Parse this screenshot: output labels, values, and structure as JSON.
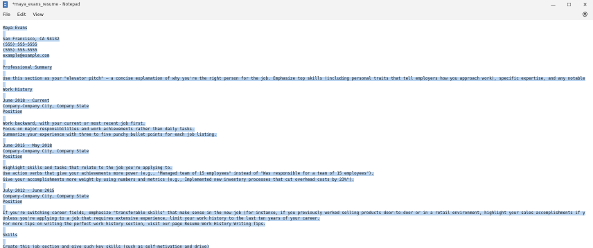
{
  "window": {
    "title": "*maya_evans_resume - Notepad",
    "controls": {
      "minimize": "—",
      "maximize": "☐",
      "close": "✕"
    }
  },
  "menu": {
    "file": "File",
    "edit": "Edit",
    "view": "View"
  },
  "document": {
    "lines": [
      "Maya Evans",
      "",
      "San Francisco, CA 94132",
      "(555) 555-5555",
      "(555) 555-5555",
      "example@example.com",
      "",
      "Professional Summary",
      "",
      "Use this section as your \"elevator pitch\" – a concise explanation of why you're the right person for the job. Emphasize top skills (including personal traits that tell employers how you approach work), specific expertise, and any notable",
      "",
      "Work History",
      "",
      "June 2018 - Current",
      "Company-Company City, Company State",
      "Position",
      "",
      "Work backward, with your current or most recent job first.",
      "Focus on major responsibilities and work achievements rather than daily tasks.",
      "Summarize your experience with three to five punchy bullet points for each job listing.",
      "",
      "June 2015 - May 2018",
      "Company-Company City, Company State",
      "Position",
      "",
      "Highlight skills and tasks that relate to the job you're applying to.",
      "Use action verbs that give your achievements more power (e.g., \"Managed team of 15 employees\" instead of \"Was responsible for a team of 15 employees\").",
      "Give your accomplishments more weight by using numbers and metrics (e.g., Implemented new inventory processes that cut overhead costs by 23%\").",
      "",
      "July 2012 - June 2015",
      "Company-Company City, Company State",
      "Position",
      "",
      "If you're switching career fields, emphasize \"transferable skills\" that make sense in the new job (for instance, if you previously worked selling products door-to-door or in a retail environment, highlight your sales accomplishments if y",
      "Unless you're applying to a job that requires extensive experience, limit your work history to the last ten years of your career.",
      "For more tips on writing the perfect work history section, visit our page Resume Work History Writing Tips.",
      "",
      "Skills",
      "",
      "Create this job section and give such key skills (such as self-motivation and drive)"
    ]
  }
}
